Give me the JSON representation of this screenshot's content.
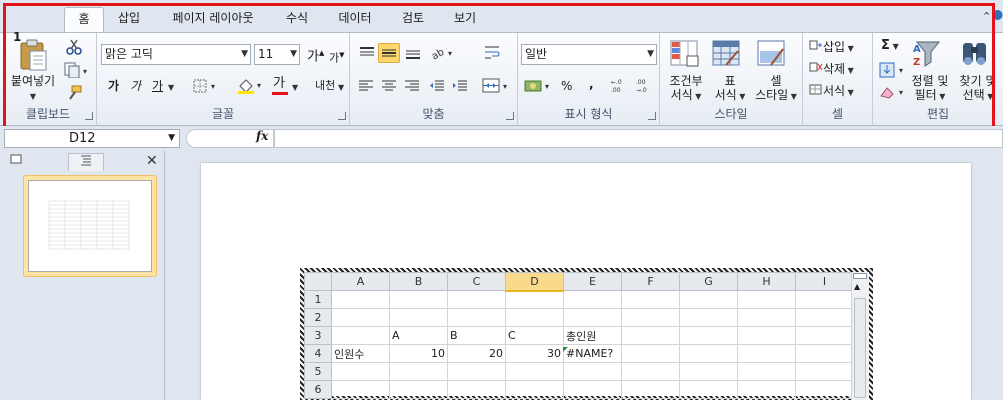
{
  "ribbon_tabs": [
    {
      "label": "홈",
      "active": true
    },
    {
      "label": "삽입"
    },
    {
      "label": "페이지 레이아웃"
    },
    {
      "label": "수식"
    },
    {
      "label": "데이터"
    },
    {
      "label": "검토"
    },
    {
      "label": "보기"
    }
  ],
  "clipboard": {
    "paste_label": "붙여넣기",
    "group_label": "클립보드"
  },
  "font": {
    "font_name": "맑은 고딕",
    "font_size": "11",
    "grow_label": "가",
    "shrink_label": "가",
    "bold_label": "가",
    "italic_label": "가",
    "underline_label": "가",
    "font_color_label": "가",
    "phonetic_label": "내천",
    "group_label": "글꼴"
  },
  "alignment": {
    "group_label": "맞춤"
  },
  "number": {
    "format": "일반",
    "percent_label": "%",
    "comma_label": ",",
    "group_label": "표시 형식"
  },
  "styles": {
    "conditional_label_1": "조건부",
    "conditional_label_2": "서식",
    "table_label_1": "표",
    "table_label_2": "서식",
    "cell_label_1": "셀",
    "cell_label_2": "스타일",
    "group_label": "스타일"
  },
  "cells": {
    "insert_label": "삽입",
    "delete_label": "삭제",
    "format_label": "서식",
    "group_label": "셀"
  },
  "editing": {
    "sigma_label": "Σ",
    "sort_label_1": "정렬 및",
    "sort_label_2": "필터",
    "find_label_1": "찾기 및",
    "find_label_2": "선택",
    "group_label": "편집"
  },
  "formula_bar": {
    "name_box": "D12",
    "fx_label": "fx",
    "formula": ""
  },
  "slides_pane": {
    "slide_number": "1"
  },
  "sheet": {
    "columns": [
      "A",
      "B",
      "C",
      "D",
      "E",
      "F",
      "G",
      "H",
      "I"
    ],
    "selected_column": "D",
    "rows": [
      {
        "num": "1",
        "cells": [
          "",
          "",
          "",
          "",
          "",
          "",
          "",
          "",
          ""
        ]
      },
      {
        "num": "2",
        "cells": [
          "",
          "",
          "",
          "",
          "",
          "",
          "",
          "",
          ""
        ]
      },
      {
        "num": "3",
        "cells": [
          "",
          "A",
          "B",
          "C",
          "총인원",
          "",
          "",
          "",
          ""
        ]
      },
      {
        "num": "4",
        "cells": [
          "인원수",
          "10",
          "20",
          "30",
          "#NAME?",
          "",
          "",
          "",
          ""
        ]
      },
      {
        "num": "5",
        "cells": [
          "",
          "",
          "",
          "",
          "",
          "",
          "",
          "",
          ""
        ]
      },
      {
        "num": "6",
        "cells": [
          "",
          "",
          "",
          "",
          "",
          "",
          "",
          "",
          ""
        ]
      }
    ]
  }
}
